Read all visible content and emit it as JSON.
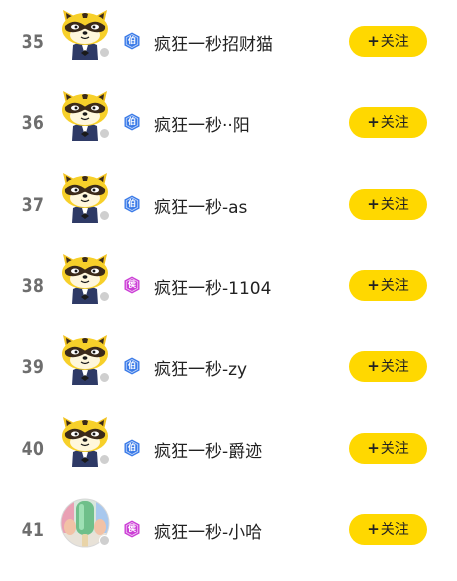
{
  "users": [
    {
      "rank": "35",
      "name": "疯狂一秒招财猫",
      "badge_text": "伯",
      "badge_color": "#3b7be8",
      "avatar": "raccoon-mascot",
      "follow_label": "关注",
      "follow_icon": "+"
    },
    {
      "rank": "36",
      "name": "疯狂一秒··阳",
      "badge_text": "伯",
      "badge_color": "#3b7be8",
      "avatar": "raccoon-mascot",
      "follow_label": "关注",
      "follow_icon": "+"
    },
    {
      "rank": "37",
      "name": "疯狂一秒-as",
      "badge_text": "伯",
      "badge_color": "#3b7be8",
      "avatar": "raccoon-mascot",
      "follow_label": "关注",
      "follow_icon": "+"
    },
    {
      "rank": "38",
      "name": "疯狂一秒-1104",
      "badge_text": "侯",
      "badge_color": "#cc3fd6",
      "avatar": "raccoon-mascot",
      "follow_label": "关注",
      "follow_icon": "+"
    },
    {
      "rank": "39",
      "name": "疯狂一秒-zy",
      "badge_text": "伯",
      "badge_color": "#3b7be8",
      "avatar": "raccoon-mascot",
      "follow_label": "关注",
      "follow_icon": "+"
    },
    {
      "rank": "40",
      "name": "疯狂一秒-爵迹",
      "badge_text": "伯",
      "badge_color": "#3b7be8",
      "avatar": "raccoon-mascot",
      "follow_label": "关注",
      "follow_icon": "+"
    },
    {
      "rank": "41",
      "name": "疯狂一秒-小哈",
      "badge_text": "侯",
      "badge_color": "#cc3fd6",
      "avatar": "popsicle-photo",
      "follow_label": "关注",
      "follow_icon": "+"
    }
  ],
  "colors": {
    "follow_button": "#ffd800",
    "rank_text": "#6e6e6e",
    "name_text": "#222222",
    "status_dot": "#cfcfcf"
  }
}
